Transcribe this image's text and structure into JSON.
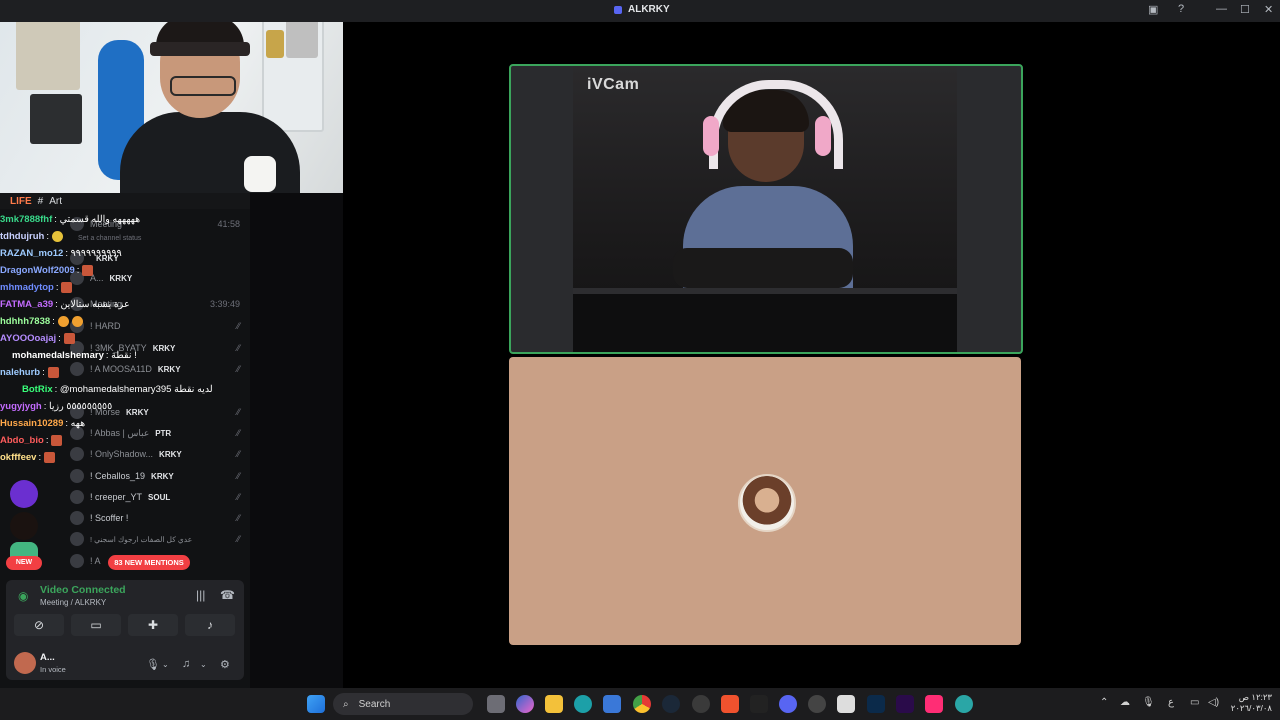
{
  "window": {
    "title": "ALKRKY",
    "help": "?",
    "minimize": "—",
    "maximize": "☐",
    "close": "✕"
  },
  "camera": {
    "label": "iVCam"
  },
  "channel_header": {
    "life_tag": "LIFE",
    "hash": "#",
    "name": "Art"
  },
  "chat": [
    {
      "user": "3mk7888fhf",
      "color": "#39d98a",
      "msg": ": هههههه والله قسمتي"
    },
    {
      "user": "tdhdujruh",
      "color": "#c9d1ff",
      "msg": ":"
    },
    {
      "user": "RAZAN_mo12",
      "color": "#9ecbff",
      "msg": ": ٩٩٩٩٩٩٩٩٩٩"
    },
    {
      "user": "DragonWolf2009",
      "color": "#8aa8ff",
      "msg": ":"
    },
    {
      "user": "mhmadytop",
      "color": "#6f8cff",
      "msg": ":"
    },
    {
      "user": "FATMA_a39",
      "color": "#c46cff",
      "msg": ": عزة يشبه ستالاين"
    },
    {
      "user": "hdhhh7838",
      "color": "#9dff9d",
      "msg": ":"
    },
    {
      "user": "AYOOOoajaj",
      "color": "#b58cff",
      "msg": ":"
    },
    {
      "user": "mohamedalshemary",
      "color": "#ffffff",
      "msg": ": نقطة !"
    },
    {
      "user": "nalehurb",
      "color": "#9ecbff",
      "msg": ":"
    },
    {
      "user": "BotRix",
      "color": "#39ff7a",
      "msg": ": @mohamedalshemary395 لديه نقطة"
    },
    {
      "user": "yugyjygh",
      "color": "#c46cff",
      "msg": ": ٥٥٥٥٥٥٥٥٥ رزيا"
    },
    {
      "user": "Hussain10289",
      "color": "#ffa84a",
      "msg": ": ههه"
    },
    {
      "user": "Abdo_bio",
      "color": "#ff5c5c",
      "msg": ":"
    },
    {
      "user": "okfffeev",
      "color": "#ffe08a",
      "msg": ":"
    }
  ],
  "members": [
    {
      "name": "Meeting",
      "tag": "",
      "right": "41:58"
    },
    {
      "name": "Set a channel status",
      "tag": "",
      "right": ""
    },
    {
      "name": "",
      "tag": "KRKY",
      "right": ""
    },
    {
      "name": "A...",
      "tag": "KRKY",
      "right": ""
    },
    {
      "name": "Meeting",
      "tag": "",
      "right": "3:39:49"
    },
    {
      "name": "! HARD",
      "tag": "",
      "right": ""
    },
    {
      "name": "! 3MK_BYATY",
      "tag": "KRKY",
      "right": ""
    },
    {
      "name": "! A MOOSA11D",
      "tag": "KRKY",
      "right": ""
    },
    {
      "name": "! Morse",
      "tag": "KRKY",
      "right": ""
    },
    {
      "name": "! Abbas | عباس",
      "tag": "PTR",
      "right": ""
    },
    {
      "name": "! OnlyShadow...",
      "tag": "KRKY",
      "right": ""
    },
    {
      "name": "! Ceballos_19",
      "tag": "KRKY",
      "right": ""
    },
    {
      "name": "! creeper_YT",
      "tag": "SOUL",
      "right": ""
    },
    {
      "name": "! Scoffer !",
      "tag": "",
      "right": ""
    },
    {
      "name": "! عدي كل الصفات ارجوك اسجني",
      "tag": "",
      "right": ""
    },
    {
      "name": "! A",
      "tag": "",
      "right": ""
    }
  ],
  "badges": {
    "new": "NEW",
    "mentions": "83 NEW MENTIONS"
  },
  "voice": {
    "status": "Video Connected",
    "location": "Meeting / ALKRKY"
  },
  "user": {
    "name": "A...",
    "status": "In voice"
  },
  "taskbar": {
    "search_placeholder": "Search",
    "time": "١٢:٢٣ ص",
    "date": "٢٠٢٦/٠٣/٠٨",
    "lang": "ع"
  },
  "colors": {
    "speaking_border": "#3ba55c",
    "avatar_tile_bg": "#c9a086",
    "mention_red": "#f23f43"
  }
}
